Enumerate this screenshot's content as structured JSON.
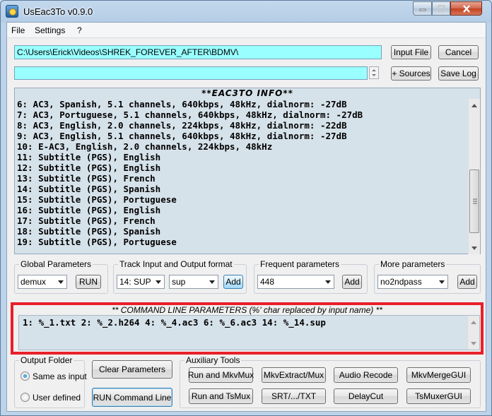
{
  "window": {
    "title": "UsEac3To v0.9.0"
  },
  "menu": {
    "file": "File",
    "settings": "Settings",
    "help": "?"
  },
  "source_path": "C:\\Users\\Erick\\Videos\\SHREK_FOREVER_AFTER\\BDMV\\",
  "source2_value": "",
  "buttons": {
    "input_file": "Input File",
    "cancel": "Cancel",
    "sources": "+ Sources",
    "save_log": "Save Log",
    "run": "RUN",
    "add": "Add",
    "clear_parameters": "Clear Parameters",
    "run_command_line": "RUN Command Line"
  },
  "info": {
    "title": "**EAC3TO INFO**",
    "lines": [
      "6: AC3, Spanish, 5.1 channels, 640kbps, 48kHz, dialnorm: -27dB",
      "7: AC3, Portuguese, 5.1 channels, 640kbps, 48kHz, dialnorm: -27dB",
      "8: AC3, English, 2.0 channels, 224kbps, 48kHz, dialnorm: -22dB",
      "9: AC3, English, 5.1 channels, 640kbps, 48kHz, dialnorm: -27dB",
      "10: E-AC3, English, 2.0 channels, 224kbps, 48kHz",
      "11: Subtitle (PGS), English",
      "12: Subtitle (PGS), English",
      "13: Subtitle (PGS), French",
      "14: Subtitle (PGS), Spanish",
      "15: Subtitle (PGS), Portuguese",
      "16: Subtitle (PGS), English",
      "17: Subtitle (PGS), French",
      "18: Subtitle (PGS), Spanish",
      "19: Subtitle (PGS), Portuguese"
    ]
  },
  "global_params": {
    "label": "Global Parameters",
    "value": "demux"
  },
  "track_format": {
    "label": "Track Input and Output format",
    "track_value": "14: SUP",
    "format_value": "sup"
  },
  "frequent_params": {
    "label": "Frequent parameters",
    "value": "448"
  },
  "more_params": {
    "label": "More parameters",
    "value": "no2ndpass"
  },
  "command_line": {
    "title": "** COMMAND LINE PARAMETERS (%' char replaced by input name) **",
    "value": "1: %_1.txt 2: %_2.h264 4: %_4.ac3 6: %_6.ac3 14: %_14.sup"
  },
  "output_folder": {
    "label": "Output Folder",
    "same_as_input": "Same as input",
    "user_defined": "User defined",
    "selected": "same_as_input"
  },
  "aux_tools": {
    "label": "Auxiliary Tools",
    "run_mkvmux": "Run and MkvMux",
    "mkvextract": "MkvExtract/Mux",
    "audio_recode": "Audio Recode",
    "mkvmergegui": "MkvMergeGUI",
    "run_tsmux": "Run and TsMux",
    "srt_txt": "SRT/.../TXT",
    "delaycut": "DelayCut",
    "tsmuxergui": "TsMuxerGUI"
  }
}
